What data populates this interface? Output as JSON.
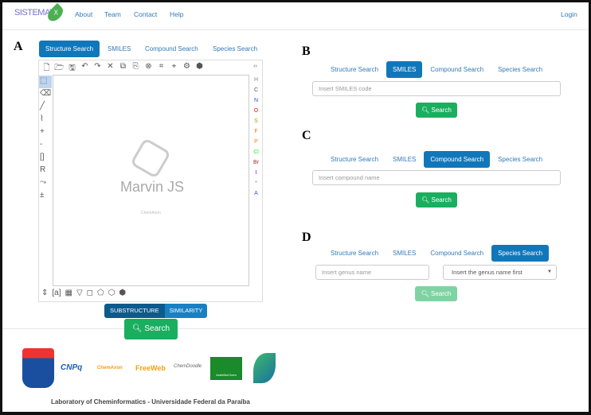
{
  "nav": {
    "brand": "SISTEMAT",
    "brand_suffix": "X",
    "links": [
      "About",
      "Team",
      "Contact",
      "Help"
    ],
    "login": "Login"
  },
  "tabs": [
    "Structure Search",
    "SMILES",
    "Compound Search",
    "Species Search"
  ],
  "panels": {
    "A": {
      "label": "A",
      "active_tab": 0,
      "editor_name": "Marvin JS",
      "editor_vendor": "ChemAxon",
      "mode_buttons": [
        "SUBSTRUCTURE",
        "SIMILARITY"
      ],
      "search": "Search"
    },
    "B": {
      "label": "B",
      "active_tab": 1,
      "placeholder": "Insert SMILES code",
      "search": "Search"
    },
    "C": {
      "label": "C",
      "active_tab": 2,
      "placeholder": "Insert compound name",
      "search": "Search"
    },
    "D": {
      "label": "D",
      "active_tab": 3,
      "genus_placeholder": "Insert genus name",
      "species_select": "Insert the genus name first",
      "search": "Search"
    }
  },
  "elements": [
    {
      "s": "H",
      "c": "#888"
    },
    {
      "s": "C",
      "c": "#555"
    },
    {
      "s": "N",
      "c": "#3050f8"
    },
    {
      "s": "O",
      "c": "#ff0d0d"
    },
    {
      "s": "S",
      "c": "#b0a000"
    },
    {
      "s": "F",
      "c": "#d08020"
    },
    {
      "s": "P",
      "c": "#ff8000"
    },
    {
      "s": "Cl",
      "c": "#1ff01f"
    },
    {
      "s": "Br",
      "c": "#a62929"
    },
    {
      "s": "I",
      "c": "#940094"
    },
    {
      "s": "*",
      "c": "#888"
    },
    {
      "s": "A",
      "c": "#3050f8"
    }
  ],
  "logos": [
    "CNPq",
    "ChemAxon",
    "FreeWeb",
    "ChemDoodle",
    "AsterBioChem"
  ],
  "footer": "Laboratory of Cheminformatics - Universidade Federal da Paraíba",
  "colors": {
    "accent": "#1177bb",
    "search": "#1aae5f"
  }
}
